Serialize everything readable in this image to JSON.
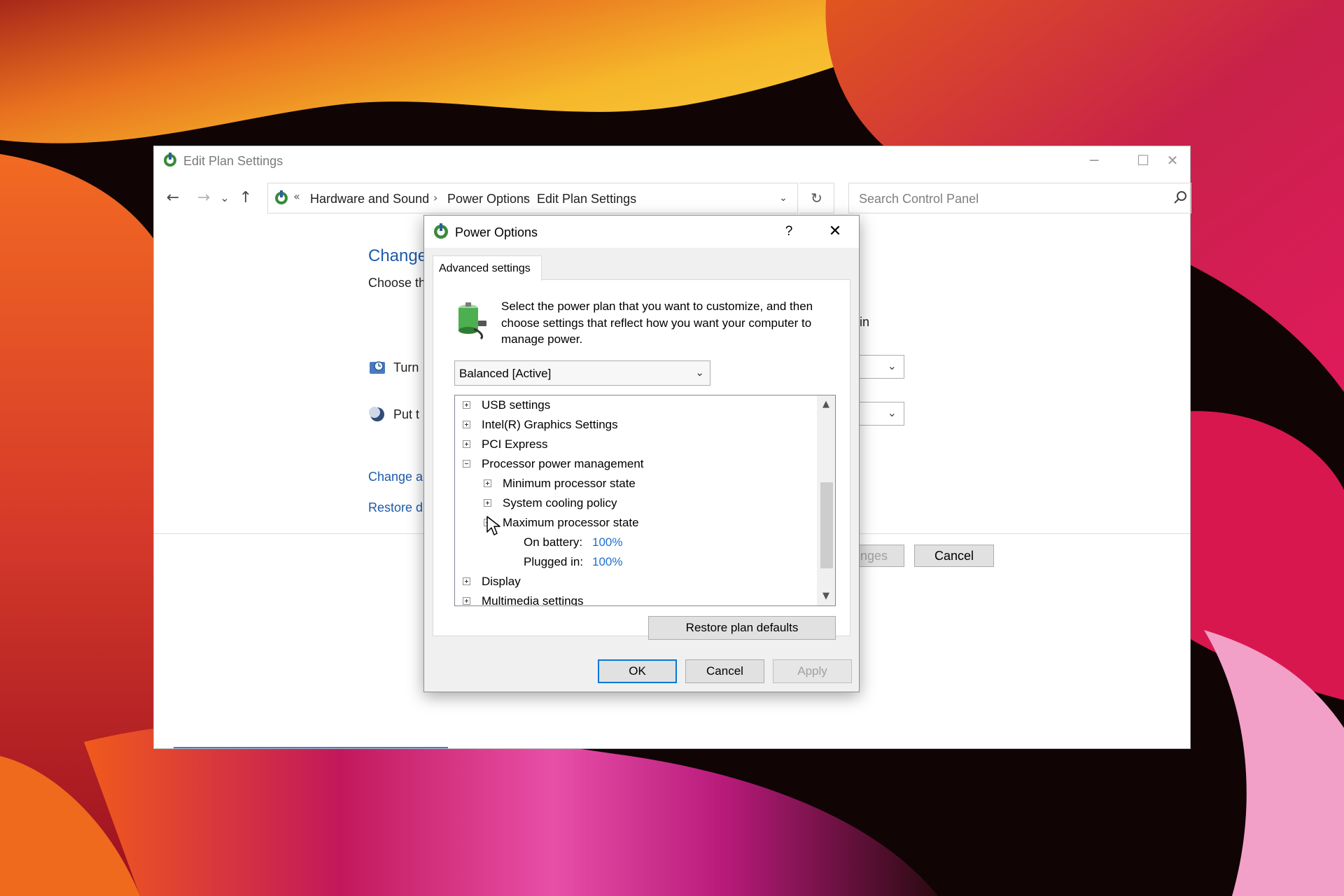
{
  "window": {
    "title": "Edit Plan Settings",
    "minimize_glyph": "─",
    "maximize_glyph": "☐",
    "close_glyph": "✕"
  },
  "nav": {
    "back_glyph": "←",
    "forward_glyph": "→",
    "recent_glyph": "⌄",
    "up_glyph": "↑"
  },
  "address": {
    "overflow": "«",
    "crumbs": [
      "Hardware and Sound",
      "Power Options",
      "Edit Plan Settings"
    ],
    "separator": "›",
    "dropdown_glyph": "⌄",
    "refresh_glyph": "↻"
  },
  "search": {
    "placeholder": "Search Control Panel",
    "icon": "search-icon"
  },
  "background_page": {
    "heading": "Change",
    "subheading": "Choose th",
    "partial_text": "in",
    "row1_label": "Turn",
    "row2_label": "Put t",
    "link1": "Change a",
    "link2": "Restore d",
    "save_button_partial": "nges",
    "cancel_button": "Cancel",
    "dropdown_glyph": "⌄"
  },
  "dialog": {
    "title": "Power Options",
    "help_glyph": "?",
    "close_glyph": "✕",
    "tab": "Advanced settings",
    "description": "Select the power plan that you want to customize, and then choose settings that reflect how you want your computer to manage power.",
    "plan_select": {
      "value": "Balanced [Active]",
      "glyph": "⌄"
    },
    "tree": {
      "usb": "USB settings",
      "intel": "Intel(R) Graphics Settings",
      "pci": "PCI Express",
      "processor": "Processor power management",
      "min_state": "Minimum processor state",
      "cooling": "System cooling policy",
      "max_state": "Maximum processor state",
      "on_battery_label": "On battery:",
      "on_battery_value": "100%",
      "plugged_in_label": "Plugged in:",
      "plugged_in_value": "100%",
      "display": "Display",
      "multimedia": "Multimedia settings"
    },
    "scroll_up_glyph": "▲",
    "scroll_down_glyph": "▼",
    "restore_button": "Restore plan defaults",
    "ok_button": "OK",
    "cancel_button": "Cancel",
    "apply_button": "Apply"
  },
  "colors": {
    "link_blue": "#1e5aa8",
    "value_blue": "#1e6fd0",
    "focus_blue": "#0078d7"
  }
}
